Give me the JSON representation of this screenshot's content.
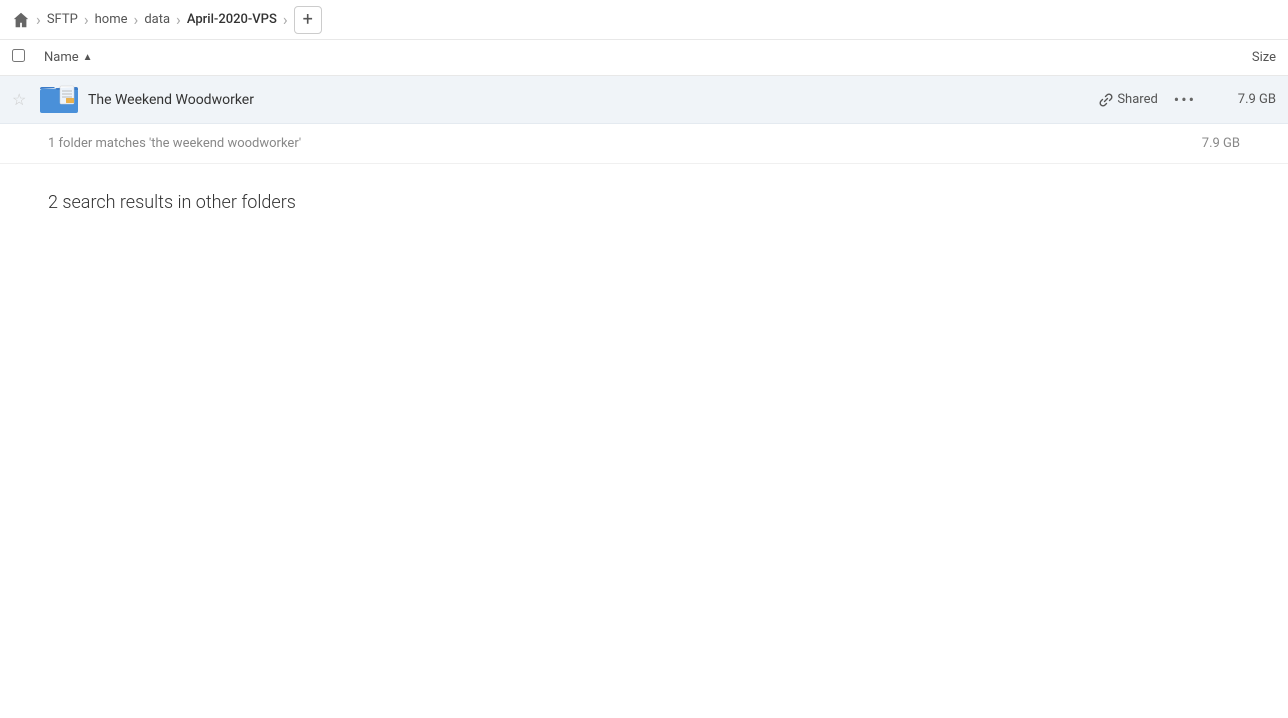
{
  "breadcrumb": {
    "home_label": "home",
    "items": [
      {
        "label": "SFTP",
        "active": false
      },
      {
        "label": "home",
        "active": false
      },
      {
        "label": "data",
        "active": false
      },
      {
        "label": "April-2020-VPS",
        "active": true
      }
    ],
    "add_button_label": "+"
  },
  "column_header": {
    "name_label": "Name",
    "sort_arrow": "▲",
    "size_label": "Size"
  },
  "file_row": {
    "name": "The Weekend Woodworker",
    "shared_label": "Shared",
    "size": "7.9 GB",
    "more_icon": "•••"
  },
  "folder_match": {
    "text": "1 folder matches 'the weekend woodworker'",
    "size": "7.9 GB"
  },
  "other_folders": {
    "heading": "2 search results in other folders"
  },
  "icons": {
    "star": "☆",
    "link": "🔗",
    "more": "…"
  }
}
